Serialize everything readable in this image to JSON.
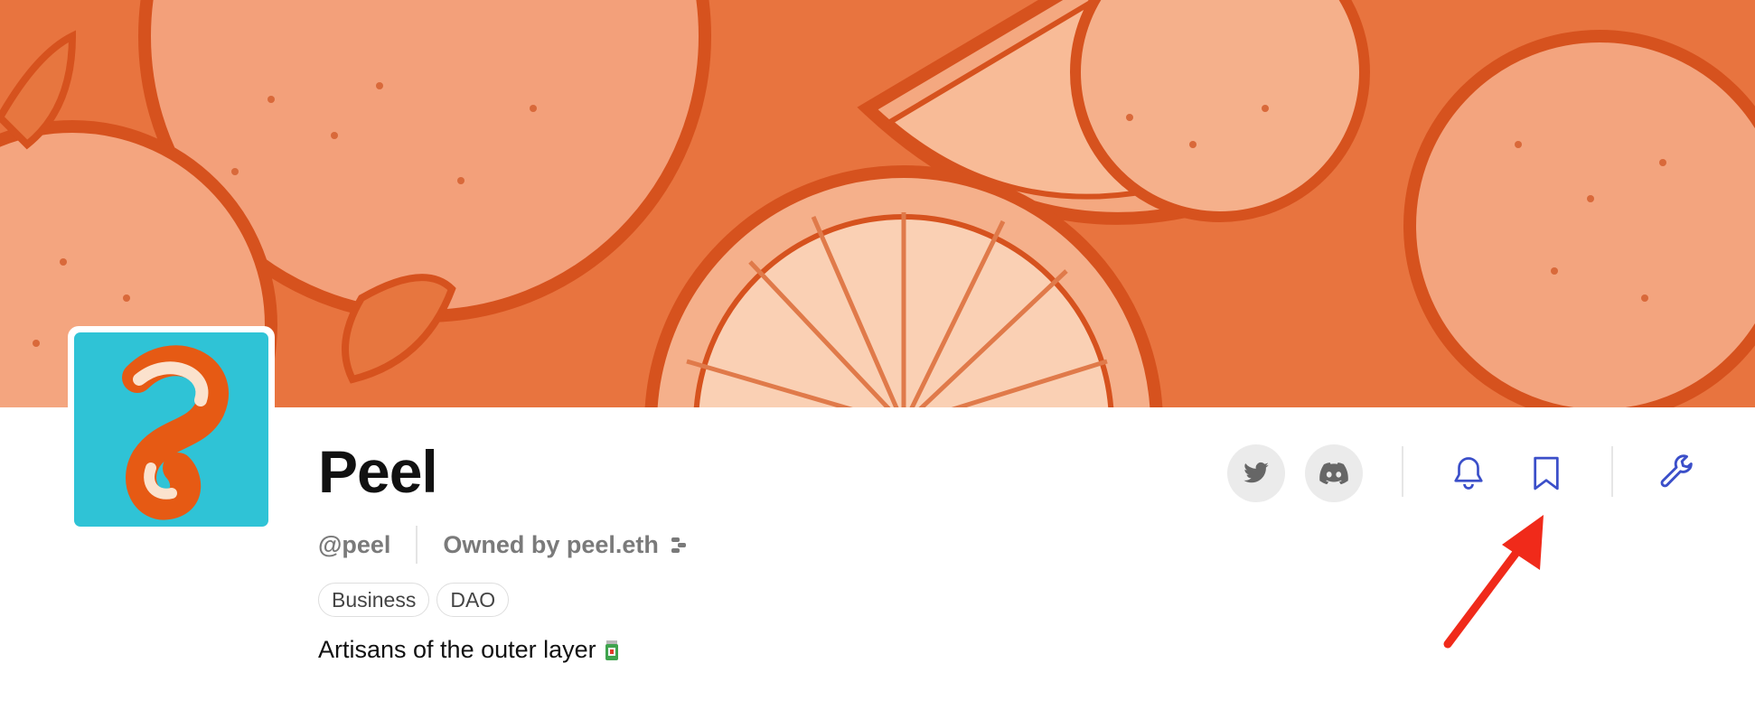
{
  "project": {
    "name": "Peel",
    "handle": "@peel",
    "owner_label": "Owned by peel.eth",
    "tags": [
      "Business",
      "DAO"
    ],
    "description": "Artisans of the outer layer"
  },
  "colors": {
    "banner_base": "#ec7a4a",
    "banner_dark": "#d9541f",
    "banner_light": "#f6ae85",
    "avatar_bg": "#2fc3d6",
    "action_icon": "#3b4fc9",
    "arrow": "#f02a1a"
  },
  "icons": {
    "twitter": "twitter-icon",
    "discord": "discord-icon",
    "notifications": "bell-icon",
    "bookmark": "bookmark-icon",
    "settings": "wrench-icon",
    "owner": "ens-icon",
    "description_emoji": "juice-jar-icon"
  }
}
